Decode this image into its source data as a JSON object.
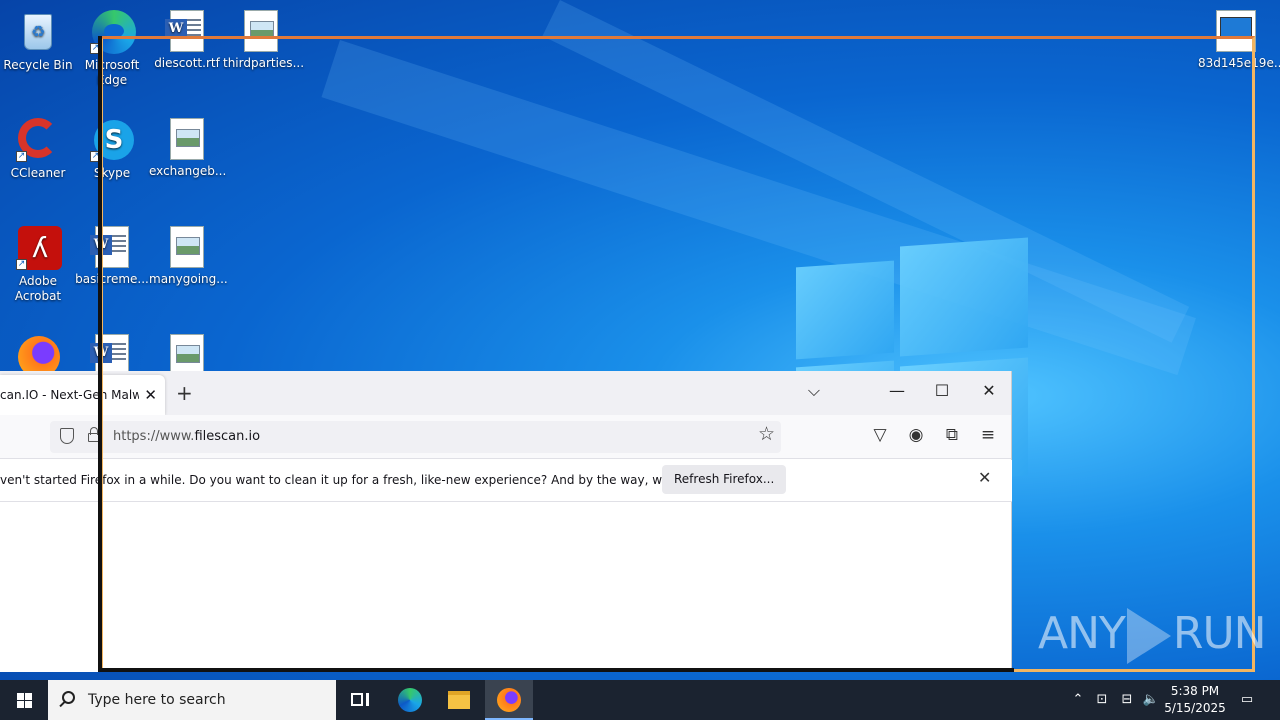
{
  "desktop": {
    "icons": [
      {
        "label": "Recycle Bin"
      },
      {
        "label": "Microsoft Edge"
      },
      {
        "label": "diescott.rtf"
      },
      {
        "label": "thirdparties..."
      },
      {
        "label": "CCleaner"
      },
      {
        "label": "Skype"
      },
      {
        "label": "exchangeb..."
      },
      {
        "label": "Adobe Acrobat"
      },
      {
        "label": "basicreme..."
      },
      {
        "label": "manygoing..."
      },
      {
        "label": "83d145e19e..."
      }
    ]
  },
  "firefox": {
    "tab_title": "can.IO - Next-Gen Malware",
    "url_prefix": "https://www.",
    "url_domain": "filescan.io",
    "notification": "ven't started Firefox in a while. Do you want to clean it up for a fresh, like-new experience? And by the way, welcome back!",
    "refresh_button": "Refresh Firefox..."
  },
  "watermark": {
    "left": "ANY",
    "right": "RUN"
  },
  "taskbar": {
    "search_placeholder": "Type here to search",
    "time": "5:38 PM",
    "date": "5/15/2025"
  },
  "colors": {
    "selection_outer": "#f2b561",
    "selection_inner": "#111111",
    "taskbar": "#1b2330"
  }
}
